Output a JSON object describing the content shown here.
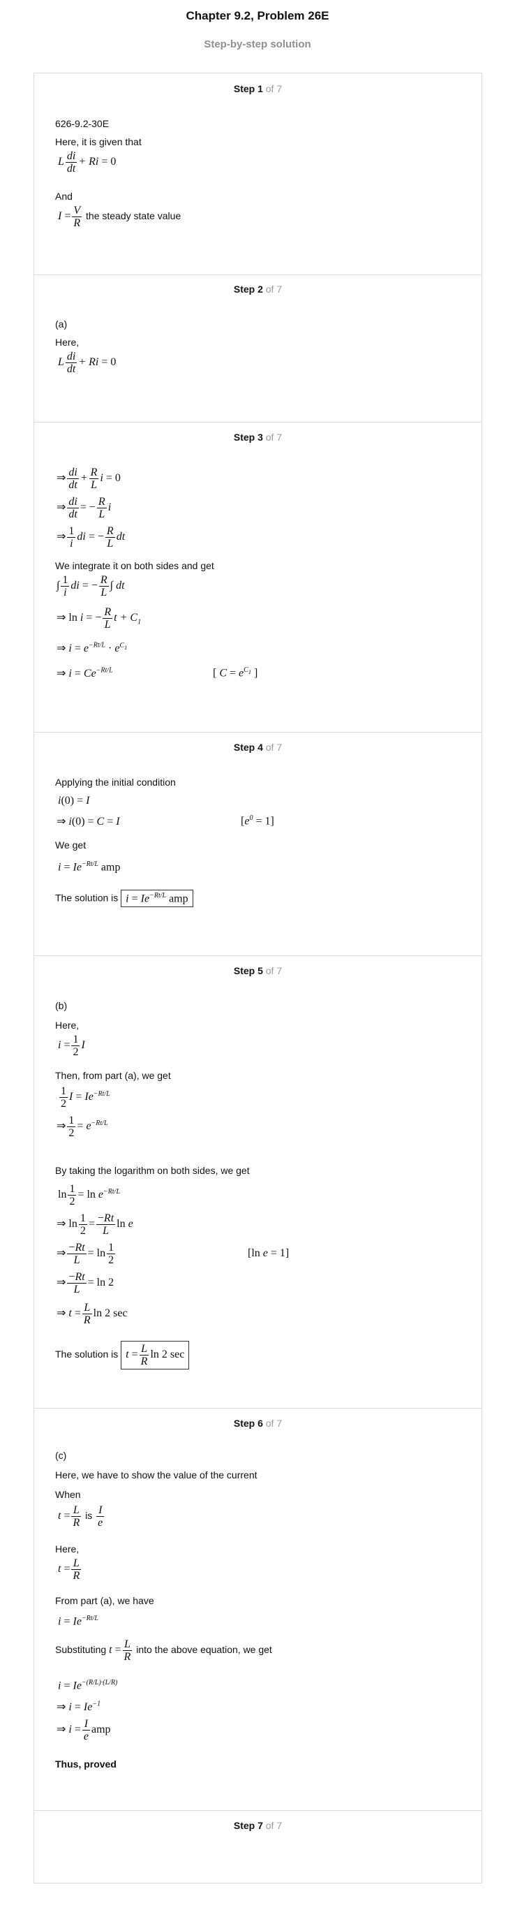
{
  "header": {
    "title": "Chapter 9.2, Problem 26E",
    "subtitle": "Step-by-step solution"
  },
  "steps": [
    {
      "label": "Step 1",
      "of": "of 7",
      "code": "626-9.2-30E",
      "t1": "Here, it is given that",
      "t2": "And",
      "t3": "the steady state value"
    },
    {
      "label": "Step 2",
      "of": "of 7",
      "t1": "(a)",
      "t2": "Here,"
    },
    {
      "label": "Step 3",
      "of": "of 7",
      "t1": "We integrate it on both sides and get"
    },
    {
      "label": "Step 4",
      "of": "of 7",
      "t1": "Applying the initial condition",
      "t2": "We get",
      "t3": "The solution is"
    },
    {
      "label": "Step 5",
      "of": "of 7",
      "t1": "(b)",
      "t2": "Here,",
      "t3": "Then, from part (a), we get",
      "t4": "By taking the logarithm on both sides, we get",
      "t5": "The solution is"
    },
    {
      "label": "Step 6",
      "of": "of 7",
      "t1": "(c)",
      "t2": "Here, we have to show the value of the current",
      "t3": "When",
      "t4": "is",
      "t5": "Here,",
      "t6": "From part (a), we have",
      "t7": "Substituting",
      "t8": "into the above equation, we get",
      "t9": "Thus, proved"
    },
    {
      "label": "Step 7",
      "of": "of 7"
    }
  ]
}
